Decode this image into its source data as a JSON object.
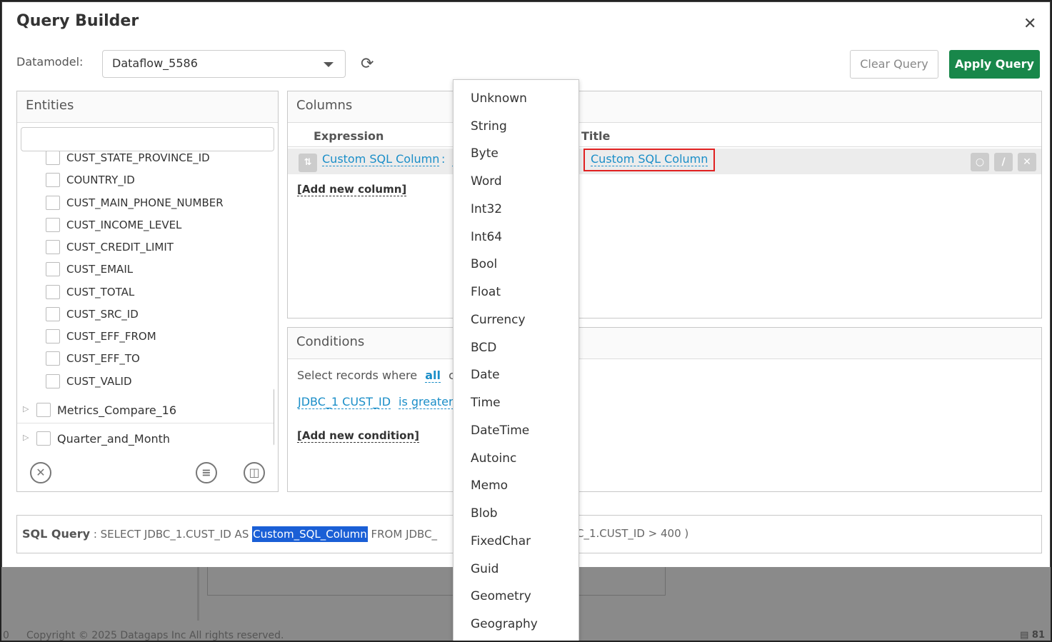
{
  "dialog": {
    "title": "Query Builder"
  },
  "datamodel": {
    "label": "Datamodel:",
    "value": "Dataflow_5586"
  },
  "toolbar": {
    "clear_label": "Clear Query",
    "apply_label": "Apply Query"
  },
  "colors": {
    "accent": "#18874a",
    "link": "#1a8ec8",
    "highlight": "#1a5fd6",
    "error_outline": "#e02020"
  },
  "entities": {
    "title": "Entities",
    "search_placeholder": "",
    "fields": [
      "CUST_STATE_PROVINCE_ID",
      "COUNTRY_ID",
      "CUST_MAIN_PHONE_NUMBER",
      "CUST_INCOME_LEVEL",
      "CUST_CREDIT_LIMIT",
      "CUST_EMAIL",
      "CUST_TOTAL",
      "CUST_SRC_ID",
      "CUST_EFF_FROM",
      "CUST_EFF_TO",
      "CUST_VALID"
    ],
    "groups": [
      "Metrics_Compare_16",
      "Quarter_and_Month"
    ],
    "footer_icons": [
      "clear-circle-icon",
      "list-circle-icon",
      "layout-circle-icon"
    ]
  },
  "columns": {
    "title": "Columns",
    "header_expression": "Expression",
    "header_title": "Title",
    "row": {
      "expression": "Custom SQL Column",
      "separator": ":",
      "cut_text": "S",
      "title": "Custom SQL Column"
    },
    "add_label": "[Add new column]"
  },
  "conditions": {
    "title": "Conditions",
    "select_prefix": "Select records where",
    "select_all": "all",
    "select_cut": "c",
    "condition_field": "JDBC_1 CUST_ID",
    "condition_op": "is greater",
    "add_label": "[Add new condition]"
  },
  "sql": {
    "label": "SQL Query",
    "colon": " : ",
    "part1": "SELECT JDBC_1.CUST_ID AS ",
    "highlight": "Custom_SQL_Column",
    "part2": " FROM JDBC_",
    "part3": "C_1.CUST_ID > 400 )"
  },
  "type_dropdown": {
    "options": [
      "Unknown",
      "String",
      "Byte",
      "Word",
      "Int32",
      "Int64",
      "Bool",
      "Float",
      "Currency",
      "BCD",
      "Date",
      "Time",
      "DateTime",
      "Autoinc",
      "Memo",
      "Blob",
      "FixedChar",
      "Guid",
      "Geometry",
      "Geography"
    ]
  },
  "background": {
    "footer": "Copyright © 2025 Datagaps Inc All rights reserved.",
    "left_num": "0",
    "page_count": "81"
  }
}
